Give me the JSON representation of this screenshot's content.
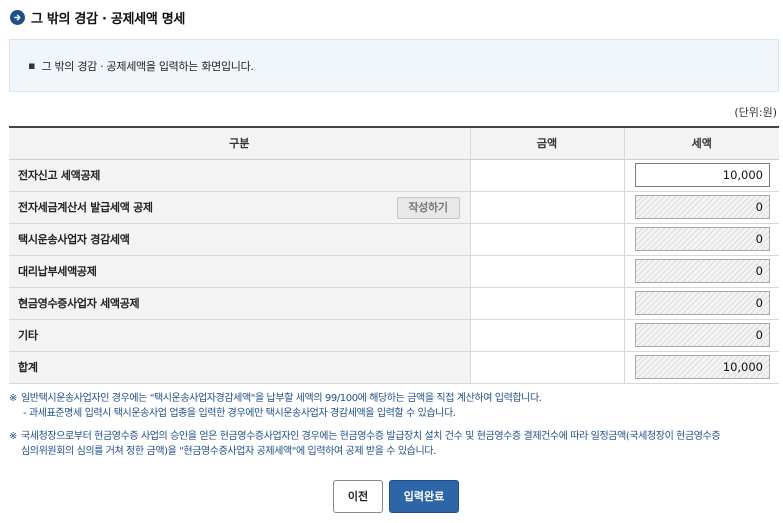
{
  "page": {
    "title": "그 밖의 경감 · 공제세액 명세",
    "info_bullet": "▪",
    "info_text": "그 밖의 경감 · 공제세액을 입력하는 화면입니다.",
    "unit_label": "(단위:원)"
  },
  "table": {
    "headers": {
      "category": "구분",
      "amount": "금액",
      "tax": "세액"
    },
    "rows": [
      {
        "label": "전자신고 세액공제",
        "amount": "",
        "tax": "10,000",
        "editable": true
      },
      {
        "label": "전자세금계산서 발급세액 공제",
        "amount": "",
        "tax": "0",
        "editable": false,
        "button": "작성하기"
      },
      {
        "label": "택시운송사업자 경감세액",
        "amount": "",
        "tax": "0",
        "editable": false
      },
      {
        "label": "대리납부세액공제",
        "amount": "",
        "tax": "0",
        "editable": false
      },
      {
        "label": "현금영수증사업자 세액공제",
        "amount": "",
        "tax": "0",
        "editable": false
      },
      {
        "label": "기타",
        "amount": "",
        "tax": "0",
        "editable": false
      },
      {
        "label": "합계",
        "amount": "",
        "tax": "10,000",
        "editable": false
      }
    ]
  },
  "notes": [
    {
      "mark": "※",
      "lines": [
        "일반택시운송사업자인 경우에는 \"택시운송사업자경감세액\"을 납부할 세액의 99/100에 해당하는 금액을 직접 계산하여 입력합니다.",
        " - 과세표준명세 입력시 택시운송사업 업종을 입력한 경우에만 택시운송사업자 경감세액을 입력할 수 있습니다."
      ]
    },
    {
      "mark": "※",
      "lines": [
        "국세청장으로부터 현금영수증 사업의 승인을 얻은 현금영수증사업자인 경우에는 현금영수증 발급장치 설치 건수 및 현금영수증 결제건수에 따라 일정금액(국세청장이 현금영수증",
        "심의위원회의 심의를 거쳐 정한 금액)을 \"현금영수증사업자 공제세액\"에 입력하여 공제 받을 수 있습니다."
      ]
    }
  ],
  "buttons": {
    "prev": "이전",
    "done": "입력완료"
  },
  "colors": {
    "accent": "#1f4f86",
    "primary_button": "#2d66a8",
    "info_bg": "#f1f6fb"
  },
  "icons": {
    "title": "arrow-right-circle-icon"
  }
}
